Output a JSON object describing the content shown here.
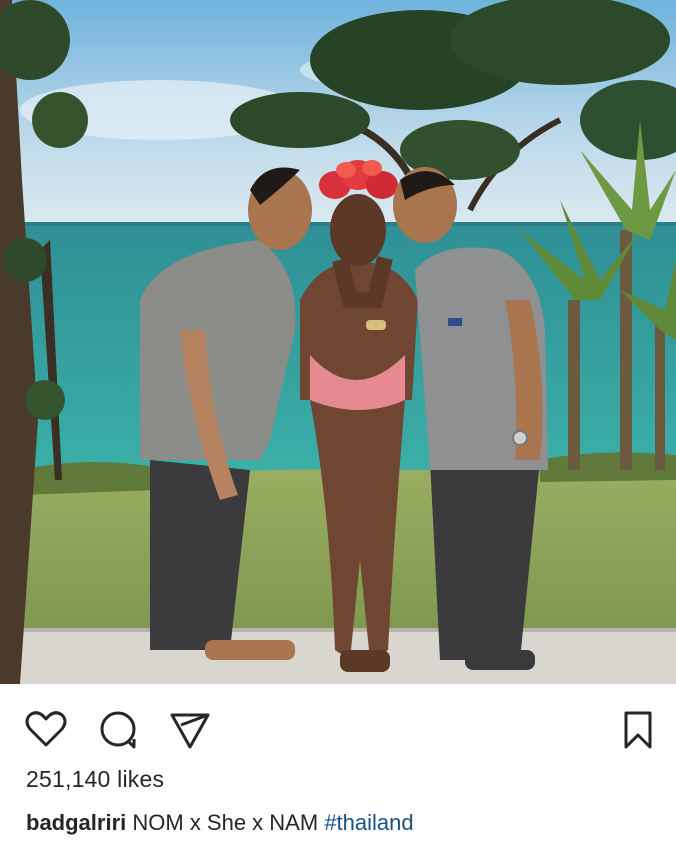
{
  "post": {
    "photo": {
      "icon": "instagram-photo",
      "description_visible": false
    },
    "actions": {
      "like_icon": "heart-icon",
      "comment_icon": "comment-icon",
      "share_icon": "share-icon",
      "save_icon": "bookmark-icon"
    },
    "likes_text": "251,140 likes",
    "caption": {
      "username": "badgalriri",
      "text": "NOM x She x NAM",
      "hashtag": "#thailand"
    }
  },
  "colors": {
    "text": "#262626",
    "hashtag": "#1a4f8a",
    "sky": "#cfe3ec",
    "sea": "#2a9a9a",
    "grass": "#8fa45c"
  }
}
